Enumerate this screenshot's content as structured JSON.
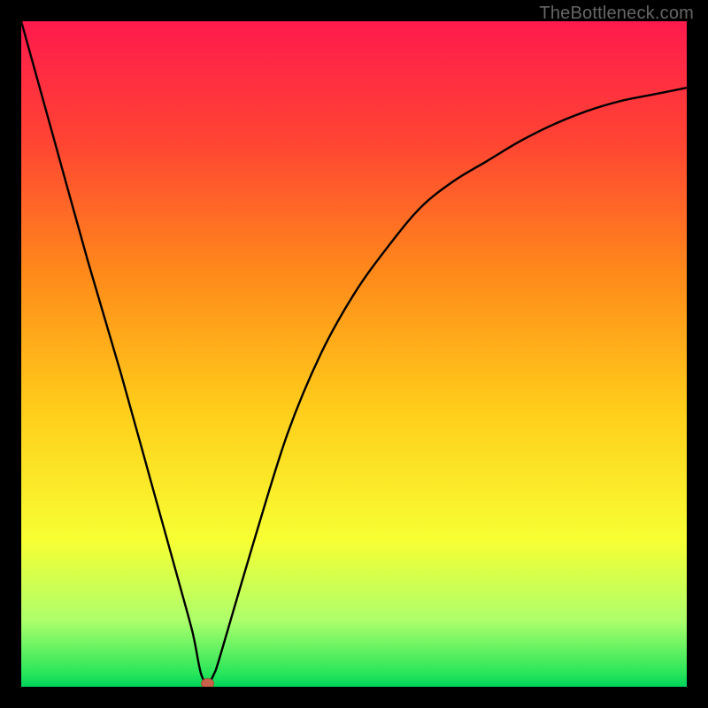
{
  "watermark": "TheBottleneck.com",
  "colors": {
    "frame": "#000000",
    "curve": "#000000",
    "marker_fill": "#c8624a",
    "marker_stroke": "#a84a35",
    "gradient_stops": [
      {
        "offset": 0.0,
        "color": "#ff1a4d"
      },
      {
        "offset": 0.18,
        "color": "#ff4433"
      },
      {
        "offset": 0.38,
        "color": "#ff8a1a"
      },
      {
        "offset": 0.58,
        "color": "#ffcc1a"
      },
      {
        "offset": 0.78,
        "color": "#f7ff33"
      },
      {
        "offset": 0.9,
        "color": "#adff6b"
      },
      {
        "offset": 0.98,
        "color": "#28e65a"
      },
      {
        "offset": 1.0,
        "color": "#00d45a"
      }
    ]
  },
  "chart_data": {
    "type": "line",
    "title": "",
    "xlabel": "",
    "ylabel": "",
    "xlim": [
      0,
      100
    ],
    "ylim": [
      0,
      100
    ],
    "grid": false,
    "legend": false,
    "marker": {
      "x": 28,
      "y": 0.5
    },
    "series": [
      {
        "name": "bottleneck-curve",
        "x": [
          0,
          5,
          10,
          15,
          20,
          25,
          26,
          27,
          28,
          29,
          30,
          35,
          40,
          45,
          50,
          55,
          60,
          65,
          70,
          75,
          80,
          85,
          90,
          95,
          100
        ],
        "y": [
          100,
          82,
          64,
          47,
          29,
          11,
          7,
          2,
          0.5,
          2,
          5,
          22,
          38,
          50,
          59,
          66,
          72,
          76,
          79,
          82,
          84.5,
          86.5,
          88,
          89,
          90
        ]
      }
    ],
    "notes": "V-shaped bottleneck curve: linear fall from 100 at x=0 to ~0 at x≈28, then asymptotic rise toward ~90 at x=100. Background is vertical red→green gradient. Marker at the minimum near x≈28."
  }
}
